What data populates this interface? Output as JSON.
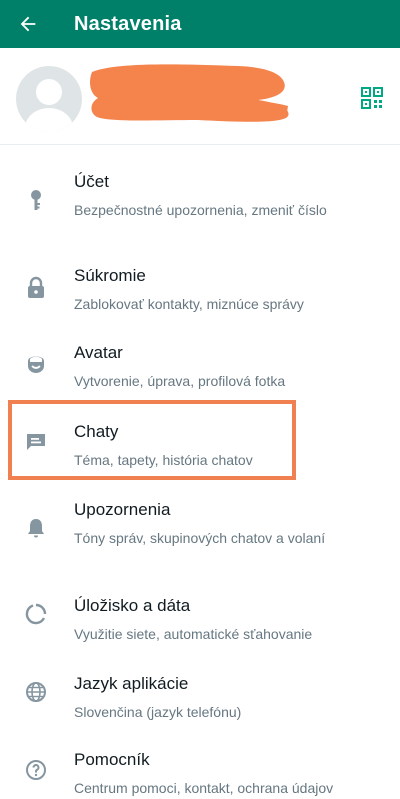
{
  "appbar": {
    "title": "Nastavenia",
    "back_icon": "arrow-left-icon",
    "background": "#008069"
  },
  "profile": {
    "avatar_icon": "default-avatar-icon",
    "qr_icon": "qr-code-icon",
    "redaction_color": "#f4844c"
  },
  "items": [
    {
      "icon": "key-icon",
      "title": "Účet",
      "subtitle": "Bezpečnostné upozornenia, zmeniť číslo"
    },
    {
      "icon": "lock-icon",
      "title": "Súkromie",
      "subtitle": "Zablokovať kontakty, miznúce správy"
    },
    {
      "icon": "avatar-face-icon",
      "title": "Avatar",
      "subtitle": "Vytvorenie, úprava, profilová fotka"
    },
    {
      "icon": "chat-icon",
      "title": "Chaty",
      "subtitle": "Téma, tapety, história chatov"
    },
    {
      "icon": "bell-icon",
      "title": "Upozornenia",
      "subtitle": "Tóny správ, skupinových chatov a volaní"
    },
    {
      "icon": "storage-circle-icon",
      "title": "Úložisko a dáta",
      "subtitle": "Využitie siete, automatické sťahovanie"
    },
    {
      "icon": "globe-icon",
      "title": "Jazyk aplikácie",
      "subtitle": "Slovenčina (jazyk telefónu)"
    },
    {
      "icon": "help-icon",
      "title": "Pomocník",
      "subtitle": "Centrum pomoci, kontakt, ochrana údajov"
    }
  ],
  "highlight": {
    "color": "#f08050",
    "target": "Chaty"
  },
  "colors": {
    "accent": "#008069",
    "qr": "#00a884",
    "icon": "#8696a0",
    "title_text": "#111b21",
    "subtitle_text": "#667781"
  }
}
